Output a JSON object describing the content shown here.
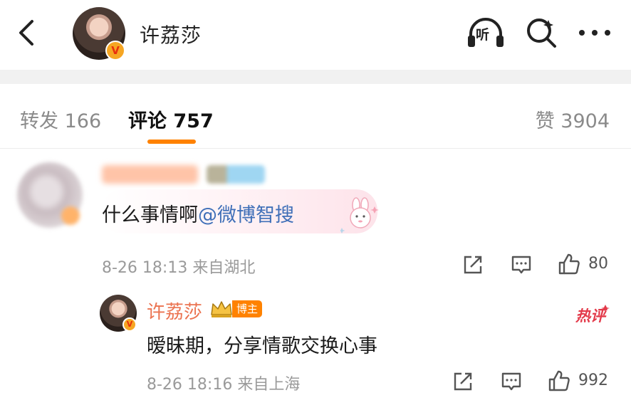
{
  "header": {
    "title": "许荔莎",
    "back_icon": "back-arrow-icon",
    "listen_label": "听",
    "verify_mark": "V"
  },
  "tabs": {
    "repost_label": "转发 166",
    "comment_label": "评论 757",
    "like_label": "赞 3904"
  },
  "comments": [
    {
      "text_prefix": "什么事情啊",
      "mention": "@微博智搜",
      "meta": "8-26 18:13  来自湖北",
      "like_count": "80",
      "reply": {
        "author": "许荔莎",
        "host_badge": "博主",
        "hot_tag": "热评",
        "text": "暧昧期，分享情歌交换心事",
        "meta": "8-26 18:16  来自上海",
        "like_count": "992",
        "verify_mark": "V"
      }
    }
  ],
  "colors": {
    "accent": "#ff8200",
    "link": "#3f6fb8",
    "author_name": "#eb7350",
    "hot": "#e33a4a"
  }
}
